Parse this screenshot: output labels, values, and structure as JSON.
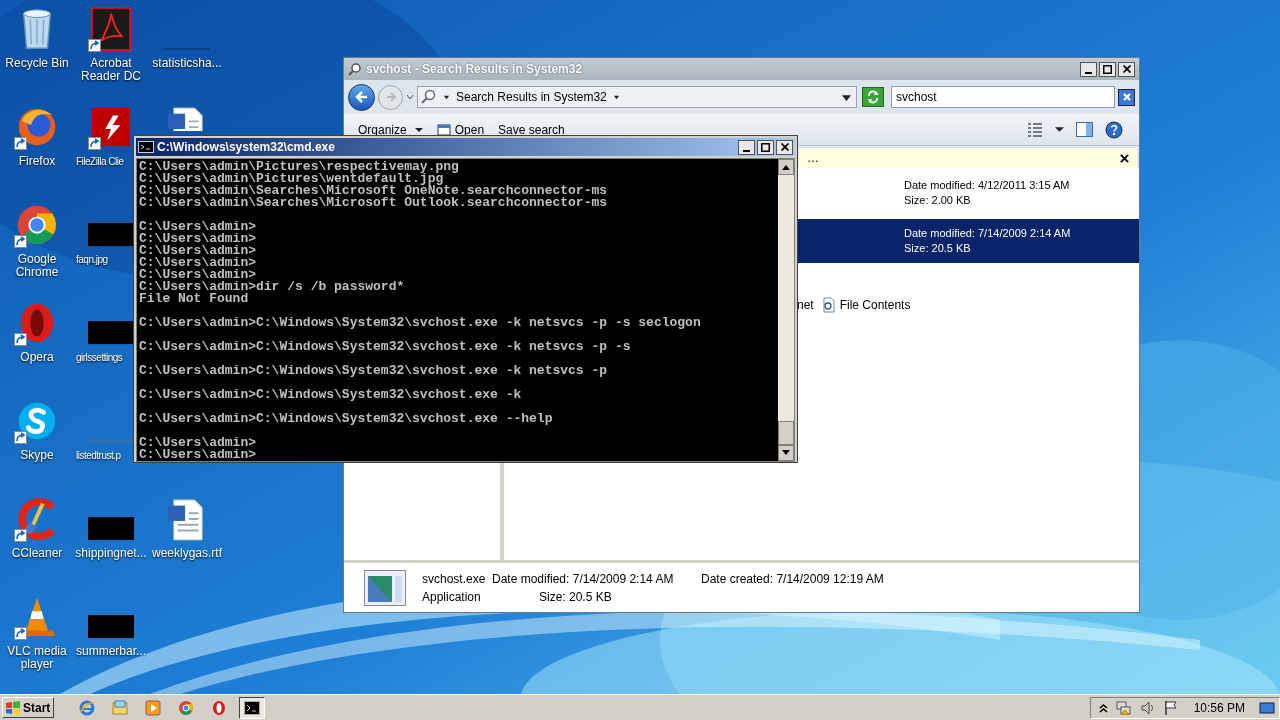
{
  "desktop": {
    "icons": [
      {
        "label": "Recycle Bin",
        "shortcut": false
      },
      {
        "label": "Firefox",
        "shortcut": true
      },
      {
        "label": "Google Chrome",
        "shortcut": true
      },
      {
        "label": "Opera",
        "shortcut": true
      },
      {
        "label": "Skype",
        "shortcut": true
      },
      {
        "label": "CCleaner",
        "shortcut": true
      },
      {
        "label": "VLC media player",
        "shortcut": true
      },
      {
        "label": "Acrobat Reader DC",
        "shortcut": true
      },
      {
        "label": "FileZilla Clie",
        "shortcut": true
      },
      {
        "label": "faqn.jpg",
        "shortcut": false
      },
      {
        "label": "girlssettings",
        "shortcut": false
      },
      {
        "label": "listedtrust.p",
        "shortcut": false
      },
      {
        "label": "shippingnet...",
        "shortcut": false
      },
      {
        "label": "summerbar...",
        "shortcut": false
      },
      {
        "label": "statisticsha...",
        "shortcut": false
      },
      {
        "shortcut": false
      },
      {
        "label": "weeklygas.rtf",
        "shortcut": false
      }
    ]
  },
  "explorer": {
    "title": "svchost - Search Results in System32",
    "breadcrumb": "Search Results in System32",
    "search": {
      "value": "svchost"
    },
    "toolbar": [
      {
        "label": "Organize",
        "kind": "menu"
      },
      {
        "label": "Open",
        "kind": "icon"
      },
      {
        "label": "Save search",
        "kind": "plain"
      }
    ],
    "info_bar": "…",
    "results": [
      {
        "date_modified": "Date modified: 4/12/2011 3:15 AM",
        "size": "Size: 2.00 KB",
        "selected": false
      },
      {
        "date_modified": "Date modified: 7/14/2009 2:14 AM",
        "size": "Size: 20.5 KB",
        "selected": true
      }
    ],
    "search_again": [
      {
        "label": "net",
        "kind": "plain"
      },
      {
        "label": "File Contents",
        "kind": "icon"
      }
    ],
    "details": {
      "name": "svchost.exe",
      "type": "Application",
      "date_modified": "Date modified: 7/14/2009 2:14 AM",
      "size": "Size: 20.5 KB",
      "date_created": "Date created: 7/14/2009 12:19 AM"
    }
  },
  "cmd": {
    "title": "C:\\Windows\\system32\\cmd.exe",
    "blocks": [
      [
        "C:\\Users\\admin\\Pictures\\respectivemay.png",
        "C:\\Users\\admin\\Pictures\\wentdefault.jpg",
        "C:\\Users\\admin\\Searches\\Microsoft OneNote.searchconnector-ms",
        "C:\\Users\\admin\\Searches\\Microsoft Outlook.searchconnector-ms"
      ],
      [
        "C:\\Users\\admin>",
        "C:\\Users\\admin>",
        "C:\\Users\\admin>",
        "C:\\Users\\admin>",
        "C:\\Users\\admin>",
        "C:\\Users\\admin>dir /s /b password*",
        "File Not Found"
      ],
      [
        "C:\\Users\\admin>C:\\Windows\\System32\\svchost.exe -k netsvcs -p -s seclogon"
      ],
      [
        "C:\\Users\\admin>C:\\Windows\\System32\\svchost.exe -k netsvcs -p -s"
      ],
      [
        "C:\\Users\\admin>C:\\Windows\\System32\\svchost.exe -k netsvcs -p"
      ],
      [
        "C:\\Users\\admin>C:\\Windows\\System32\\svchost.exe -k"
      ],
      [
        "C:\\Users\\admin>C:\\Windows\\System32\\svchost.exe --help"
      ],
      [
        "C:\\Users\\admin>",
        "C:\\Users\\admin>"
      ]
    ]
  },
  "taskbar": {
    "start": "Start",
    "clock": "10:56 PM",
    "apps": [
      {
        "active": false
      },
      {
        "active": false
      },
      {
        "active": false
      },
      {
        "active": false
      },
      {
        "active": false
      },
      {
        "active": true
      }
    ]
  }
}
